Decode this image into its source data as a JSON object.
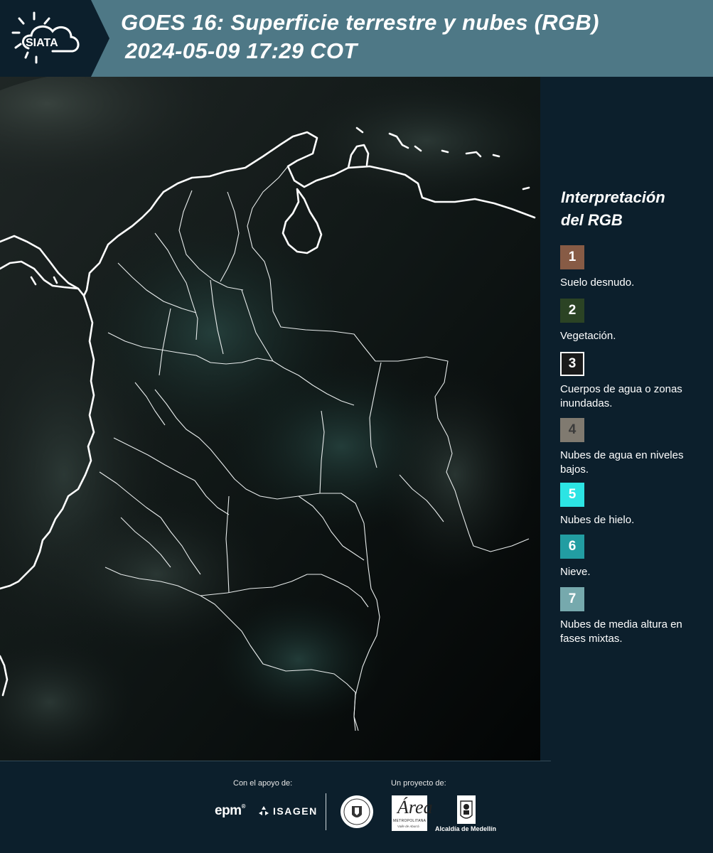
{
  "header": {
    "logo_text": "SIATA",
    "title_line1": "GOES 16: Superficie terrestre y nubes (RGB)",
    "title_line2": "2024-05-09 17:29 COT"
  },
  "legend": {
    "title_line1": "Interpretación",
    "title_line2": "del RGB",
    "items": [
      {
        "number": "1",
        "color": "#875b45",
        "label": "Suelo desnudo."
      },
      {
        "number": "2",
        "color": "#2b4324",
        "label": "Vegetación."
      },
      {
        "number": "3",
        "color": "#1a1a1a",
        "label": "Cuerpos de agua o zonas inundadas."
      },
      {
        "number": "4",
        "color": "#807a70",
        "label": "Nubes de agua en niveles bajos."
      },
      {
        "number": "5",
        "color": "#2ce4e4",
        "label": "Nubes de hielo."
      },
      {
        "number": "6",
        "color": "#229da2",
        "label": "Nieve."
      },
      {
        "number": "7",
        "color": "#76a9ad",
        "label": "Nubes de media altura en fases mixtas."
      }
    ]
  },
  "footer": {
    "support_label": "Con el apoyo de:",
    "project_label": "Un proyecto de:",
    "epm_text": "epm",
    "isagen_text": "ISAGEN",
    "metro_big": "Área",
    "metro_small": "METROPOLITANA",
    "metro_small2": "Valle de Aburrá",
    "alcaldia_text": "Alcaldía de Medellín"
  }
}
